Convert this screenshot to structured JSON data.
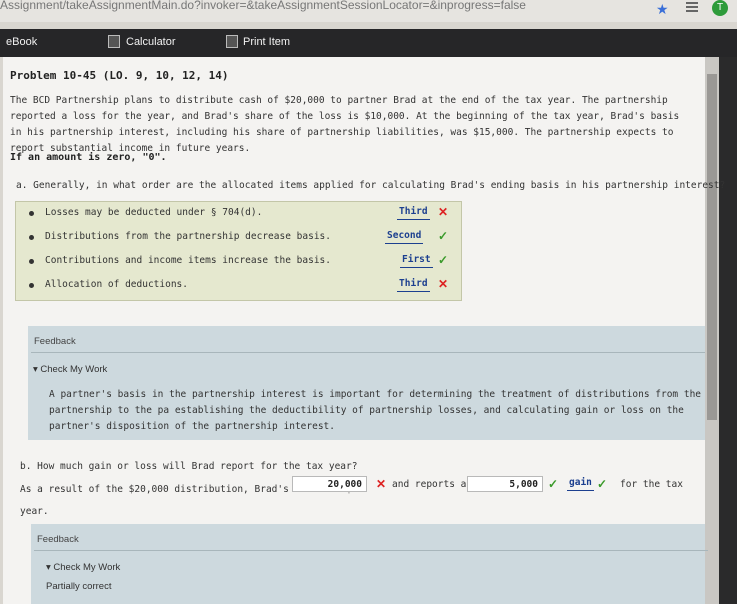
{
  "browser": {
    "url": "Assignment/takeAssignmentMain.do?invoker=&takeAssignmentSessionLocator=&inprogress=false",
    "profile_initial": "T"
  },
  "toolbar": {
    "ebook_label": "eBook",
    "calculator_label": "Calculator",
    "print_label": "Print Item"
  },
  "problem": {
    "title": "Problem 10-45 (LO. 9, 10, 12, 14)",
    "body": "The BCD Partnership plans to distribute cash of $20,000 to partner Brad at the end of the tax year. The partnership reported a loss for the year, and Brad's share of the loss is $10,000. At the beginning of the tax year, Brad's basis in his partnership interest, including his share of partnership liabilities, was $15,000. The partnership expects to report substantial income in future years.",
    "zero_note": "If an amount is zero, \"0\"."
  },
  "part_a": {
    "question": "a.  Generally, in what order are the allocated items applied for calculating Brad's ending basis in his partnership interest?",
    "items": [
      {
        "text": "Losses may be deducted under § 704(d).",
        "answer": "Third",
        "mark": "✕",
        "correct": false
      },
      {
        "text": "Distributions from the partnership decrease basis.",
        "answer": "Second",
        "mark": "✓",
        "correct": true
      },
      {
        "text": "Contributions and income items increase the basis.",
        "answer": "First",
        "mark": "✓",
        "correct": true
      },
      {
        "text": "Allocation of deductions.",
        "answer": "Third",
        "mark": "✕",
        "correct": false
      }
    ]
  },
  "feedback_a": {
    "label": "Feedback",
    "check_label": "▾ Check My Work",
    "text": "A partner's basis in the partnership interest is important for determining the treatment of distributions from the partnership to the pa establishing the deductibility of partnership losses, and calculating gain or loss on the partner's disposition of the partnership interest."
  },
  "part_b": {
    "question": "b.  How much gain or loss will Brad report for the tax year?",
    "prefix": "As a result of the $20,000 distribution, Brad's basis is $",
    "basis_value": "20,000",
    "basis_mark": "✕",
    "middle": "and reports a $",
    "gain_value": "5,000",
    "gain_mark": "✓",
    "select_value": "gain",
    "select_mark": "✓",
    "suffix": "for the tax",
    "continuation": "year."
  },
  "feedback_b": {
    "label": "Feedback",
    "check_label": "▾ Check My Work",
    "status": "Partially correct"
  },
  "colors": {
    "accent_blue": "#1c3f8f",
    "wrong_red": "#dd2222",
    "correct_green": "#3a9a2a",
    "toolbar_bg": "#262628",
    "feedback_bg": "#cdd9de",
    "answer_box_bg": "#e5e8cf"
  }
}
